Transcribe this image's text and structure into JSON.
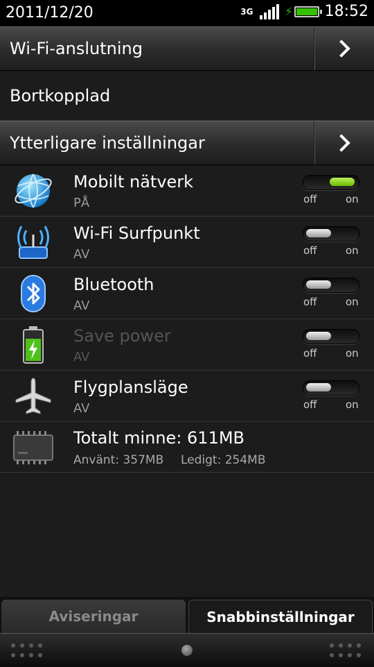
{
  "status": {
    "date": "2011/12/20",
    "network": "3G",
    "time": "18:52"
  },
  "wifi_connection": {
    "label": "Wi-Fi-anslutning"
  },
  "wifi_status": {
    "label": "Bortkopplad"
  },
  "more_settings": {
    "label": "Ytterligare inställningar"
  },
  "toggle_labels": {
    "off": "off",
    "on": "on"
  },
  "settings": [
    {
      "title": "Mobilt nätverk",
      "state": "PÅ",
      "on": true,
      "icon": "globe-icon"
    },
    {
      "title": "Wi-Fi Surfpunkt",
      "state": "AV",
      "on": false,
      "icon": "wifi-hotspot-icon"
    },
    {
      "title": "Bluetooth",
      "state": "AV",
      "on": false,
      "icon": "bluetooth-icon"
    },
    {
      "title": "Save power",
      "state": "AV",
      "on": false,
      "icon": "battery-saver-icon",
      "disabled": true
    },
    {
      "title": "Flygplansläge",
      "state": "AV",
      "on": false,
      "icon": "airplane-icon"
    }
  ],
  "memory": {
    "title": "Totalt minne: 611MB",
    "used": "Använt: 357MB",
    "free": "Ledigt: 254MB",
    "icon": "memory-chip-icon"
  },
  "tabs": {
    "notifications": "Aviseringar",
    "quick_settings": "Snabbinställningar"
  },
  "colors": {
    "accent_green": "#6cb800",
    "battery_green": "#37c000",
    "background": "#1c1c1c"
  }
}
